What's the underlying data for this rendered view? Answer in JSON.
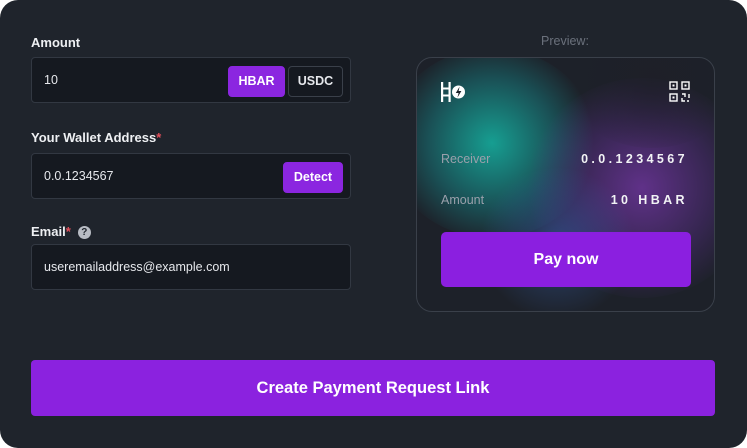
{
  "form": {
    "amount": {
      "label": "Amount",
      "value": "10",
      "currencies": [
        "HBAR",
        "USDC"
      ],
      "selected_currency": "HBAR"
    },
    "wallet": {
      "label": "Your Wallet Address",
      "required_mark": "*",
      "value": "0.0.1234567",
      "detect_label": "Detect"
    },
    "email": {
      "label": "Email",
      "required_mark": "*",
      "help_glyph": "?",
      "value": "useremailaddress@example.com"
    }
  },
  "preview": {
    "label": "Preview:",
    "receiver_label": "Receiver",
    "receiver_value": "0.0.1234567",
    "amount_label": "Amount",
    "amount_value": "10 HBAR",
    "pay_label": "Pay now",
    "logo_icon": "hedera-hbar-logo-icon",
    "qr_icon": "qr-code-icon"
  },
  "create_button_label": "Create Payment Request Link",
  "colors": {
    "background": "#1f242c",
    "field_bg": "#151920",
    "accent": "#8b26e0",
    "required": "#e4505c"
  }
}
